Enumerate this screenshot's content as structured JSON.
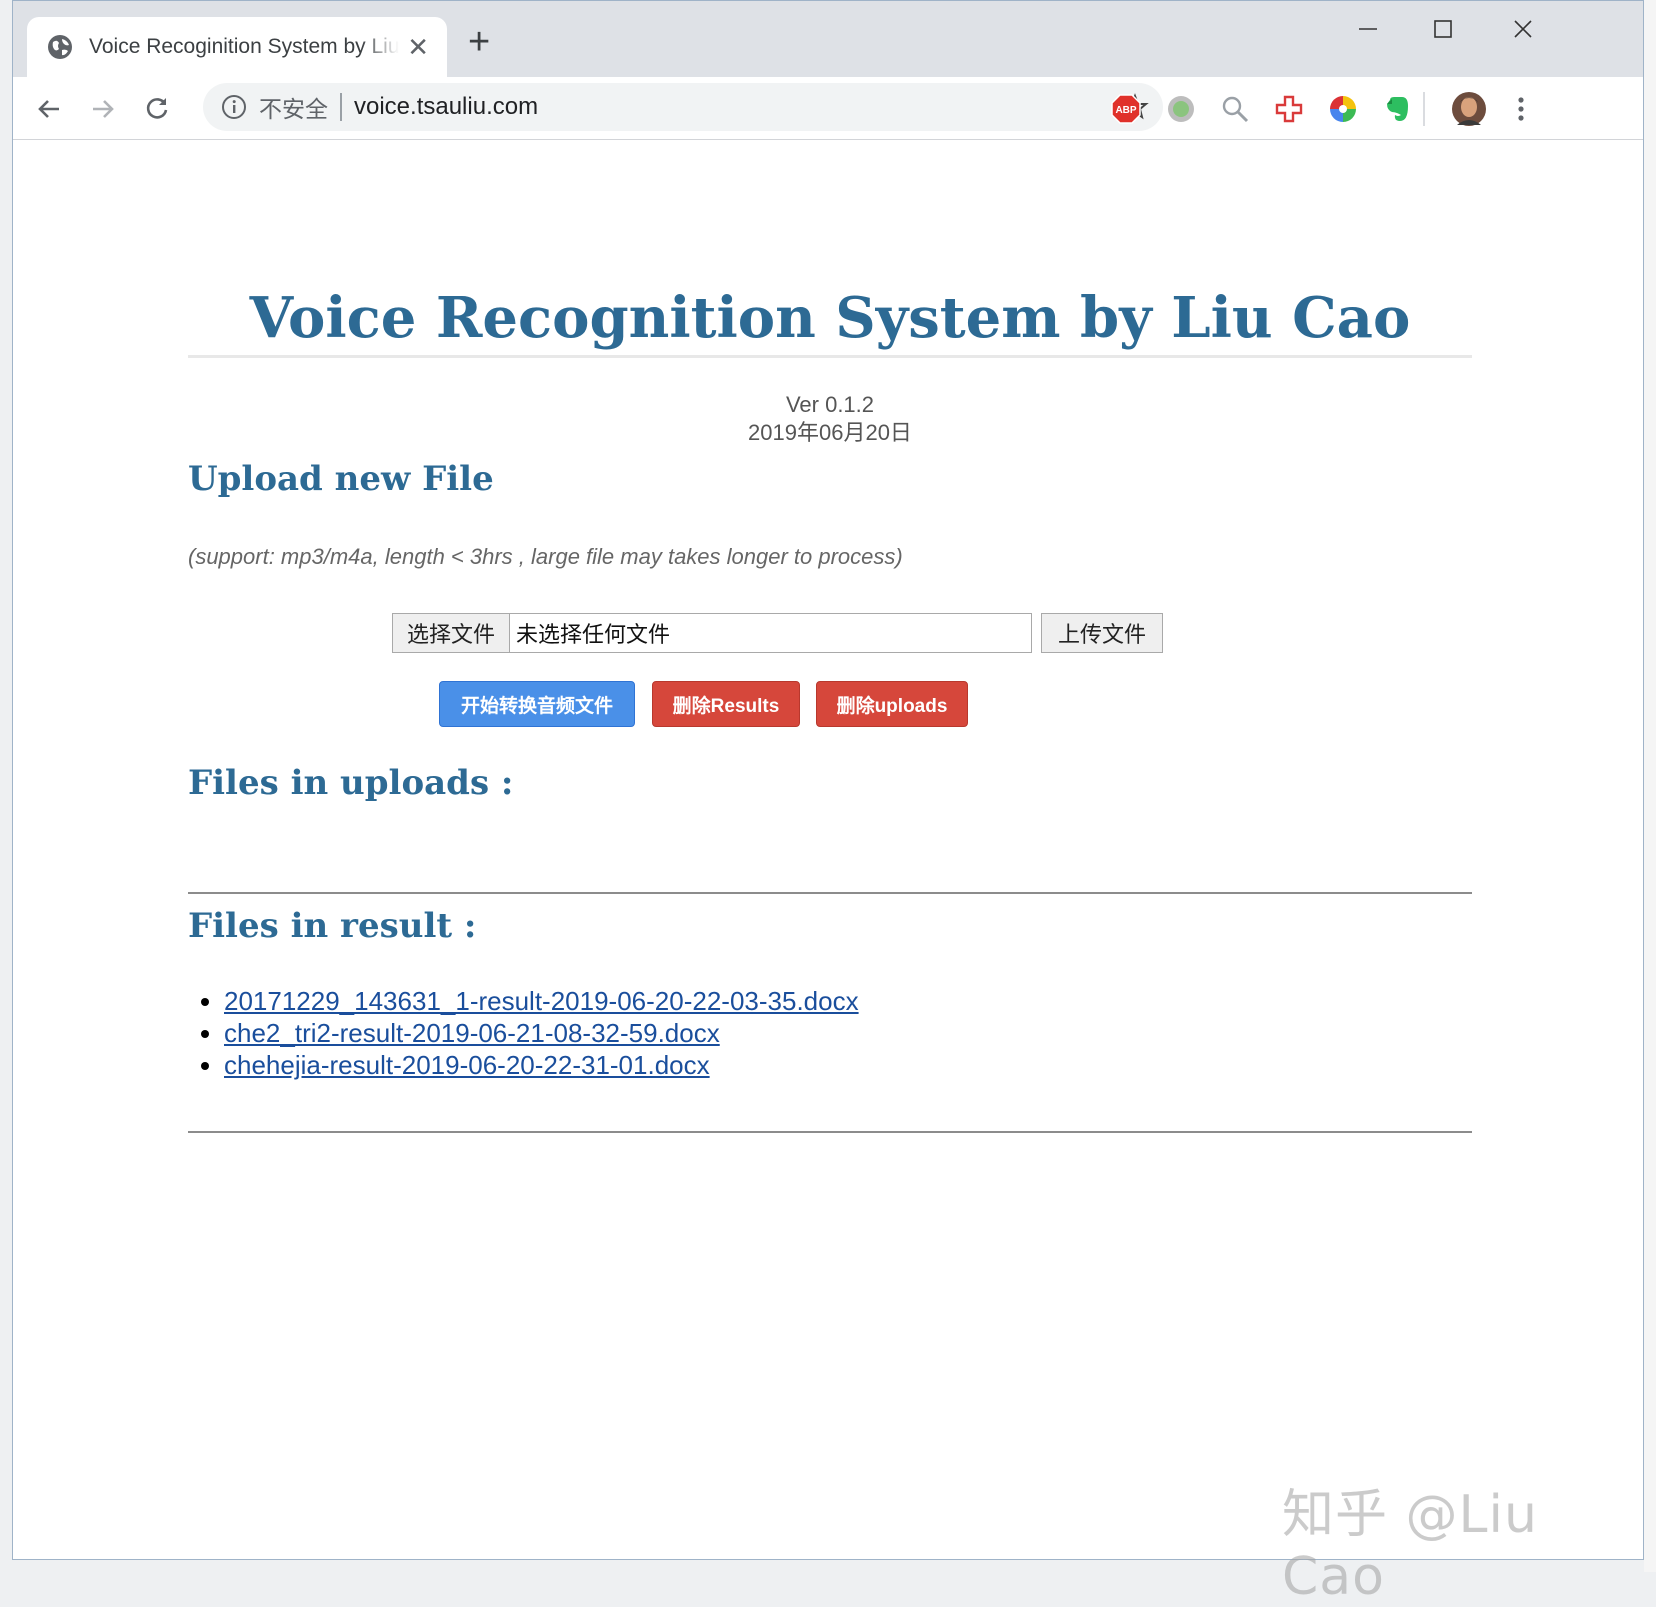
{
  "browser": {
    "tab_title": "Voice Recoginition System by Liu Cao",
    "tab_close": "✕",
    "new_tab": "+",
    "insecure_label": "不安全",
    "url": "voice.tsauliu.com",
    "extensions": [
      "abp-icon",
      "circle-extension-icon",
      "search-extension-icon",
      "medical-cross-extension-icon",
      "color-wheel-extension-icon",
      "evernote-icon"
    ],
    "abp_label": "ABP"
  },
  "page": {
    "title": "Voice Recognition System by Liu Cao",
    "version": "Ver 0.1.2",
    "date": "2019年06月20日",
    "upload_heading": "Upload new File",
    "support_note": "(support: mp3/m4a, length < 3hrs , large file may takes longer to process)",
    "choose_file_label": "选择文件",
    "no_file_label": "未选择任何文件",
    "upload_label": "上传文件",
    "convert_label": "开始转换音频文件",
    "delete_results_label": "删除Results",
    "delete_uploads_label": "删除uploads",
    "uploads_heading": "Files in uploads :",
    "results_heading": "Files in result :",
    "results": [
      "20171229_143631_1-result-2019-06-20-22-03-35.docx",
      "che2_tri2-result-2019-06-21-08-32-59.docx",
      "chehejia-result-2019-06-20-22-31-01.docx"
    ]
  },
  "watermark": "知乎 @Liu Cao",
  "colors": {
    "heading": "#2d6a94",
    "convert_button": "#4a90e8",
    "delete_button": "#d6473b",
    "link": "#1a4e9c"
  }
}
